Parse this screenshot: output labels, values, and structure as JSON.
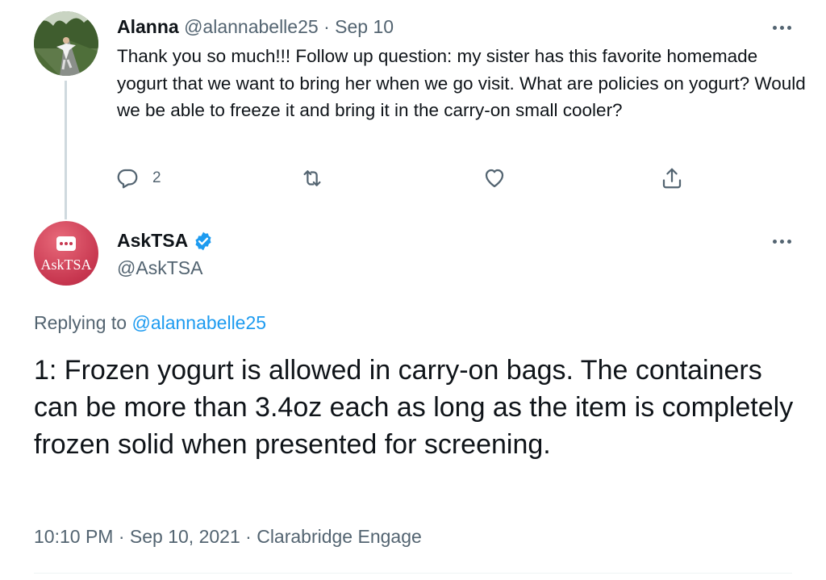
{
  "tweet1": {
    "name": "Alanna",
    "handle": "@alannabelle25",
    "separator": "·",
    "date": "Sep 10",
    "text": "Thank you so much!!! Follow up question: my sister has this favorite homemade yogurt that we want to bring her when we go visit. What are policies on yogurt? Would we be able to freeze it and bring it in the carry-on small cooler?",
    "reply_count": "2"
  },
  "tweet2": {
    "name": "AskTSA",
    "handle": "@AskTSA",
    "avatar_label": "AskTSA",
    "replying_prefix": "Replying to",
    "replying_to": "@alannabelle25",
    "text": "1: Frozen yogurt is allowed in carry-on bags. The containers can be more than 3.4oz each as long as the item is completely frozen solid when presented for screening.",
    "time": "10:10 PM",
    "separator": "·",
    "date": "Sep 10, 2021",
    "source": "Clarabridge Engage"
  },
  "colors": {
    "text": "#0f1419",
    "muted": "#536471",
    "link": "#1d9bf0",
    "verified": "#1d9bf0",
    "tsa_avatar": "#c7364f"
  },
  "icons": {
    "reply": "reply-icon",
    "retweet": "retweet-icon",
    "like": "heart-icon",
    "share": "share-icon",
    "more": "more-icon",
    "verified": "verified-badge-icon"
  }
}
